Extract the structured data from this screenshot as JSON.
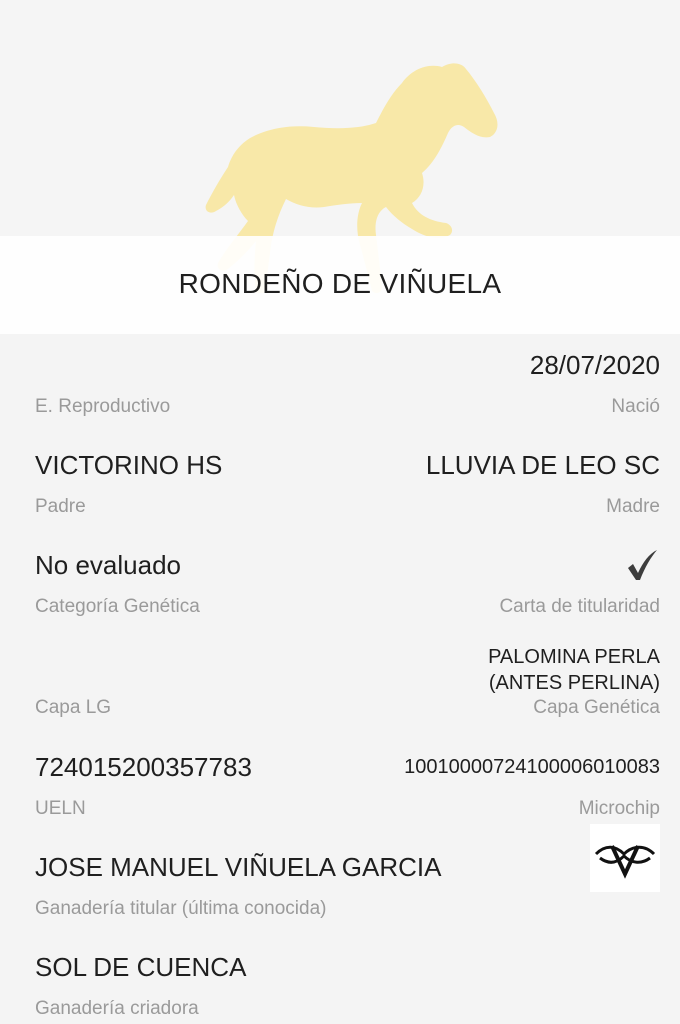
{
  "horse": {
    "name": "RONDEÑO DE VIÑUELA"
  },
  "fields": {
    "estado_reproductivo": {
      "value": "",
      "label": "E. Reproductivo"
    },
    "nacio": {
      "value": "28/07/2020",
      "label": "Nació"
    },
    "padre": {
      "value": "VICTORINO HS",
      "label": "Padre"
    },
    "madre": {
      "value": "LLUVIA DE LEO SC",
      "label": "Madre"
    },
    "categoria_genetica": {
      "value": "No evaluado",
      "label": "Categoría Genética"
    },
    "carta_titularidad": {
      "checked": true,
      "label": "Carta de titularidad"
    },
    "capa_lg": {
      "value": "",
      "label": "Capa LG"
    },
    "capa_genetica": {
      "value_line1": "PALOMINA PERLA",
      "value_line2": "(ANTES PERLINA)",
      "label": "Capa Genética"
    },
    "ueln": {
      "value": "724015200357783",
      "label": "UELN"
    },
    "microchip": {
      "value": "100100007241000060100​83",
      "label": "Microchip"
    },
    "ganaderia_titular": {
      "value": "JOSE MANUEL VIÑUELA GARCIA",
      "label": "Ganadería titular (última conocida)"
    },
    "ganaderia_criadora": {
      "value": "SOL DE CUENCA",
      "label": "Ganadería criadora"
    }
  },
  "icons": {
    "logo": "horse-silhouette-icon",
    "check": "checkmark-icon",
    "brand": "ganaderia-brand-icon"
  },
  "colors": {
    "logo": "#f7e6a4",
    "text": "#1f1f1f",
    "label": "#9a9a9a",
    "background": "#f4f4f4"
  }
}
